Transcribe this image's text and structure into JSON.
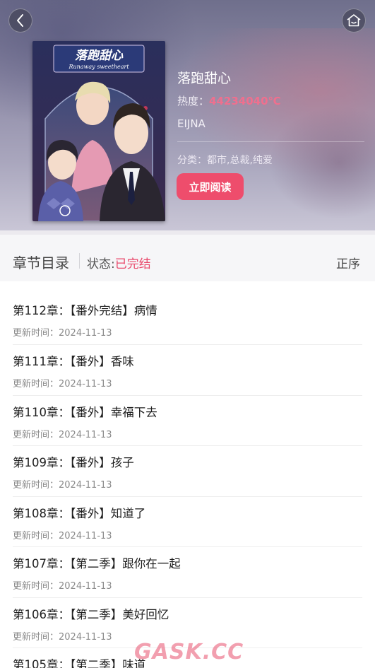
{
  "header": {
    "back_icon": "chevron-left-icon",
    "home_icon": "home-icon",
    "book": {
      "title": "落跑甜心",
      "heat_label": "热度：",
      "heat_value": "44234040℃",
      "author": "EIJNA",
      "category_label": "分类：",
      "category_value": "都市,总裁,纯爱",
      "read_button": "立即阅读"
    },
    "cover": {
      "title_cn": "落跑甜心",
      "title_en": "Runaway sweetheart"
    }
  },
  "section": {
    "title": "章节目录",
    "status_label": "状态:",
    "status_value": "已完结",
    "order_label": "正序"
  },
  "chapters": [
    {
      "title": "第112章：【番外完结】病情",
      "time": "更新时间：2024-11-13"
    },
    {
      "title": "第111章：【番外】香味",
      "time": "更新时间：2024-11-13"
    },
    {
      "title": "第110章：【番外】幸福下去",
      "time": "更新时间：2024-11-13"
    },
    {
      "title": "第109章：【番外】孩子",
      "time": "更新时间：2024-11-13"
    },
    {
      "title": "第108章：【番外】知道了",
      "time": "更新时间：2024-11-13"
    },
    {
      "title": "第107章：【第二季】跟你在一起",
      "time": "更新时间：2024-11-13"
    },
    {
      "title": "第106章：【第二季】美好回忆",
      "time": "更新时间：2024-11-13"
    },
    {
      "title": "第105章：【第二季】味道",
      "time": ""
    }
  ],
  "watermark": "GASK.CC",
  "colors": {
    "accent": "#ee4d6c",
    "heat": "#f06f8e",
    "status": "#e9496b"
  }
}
